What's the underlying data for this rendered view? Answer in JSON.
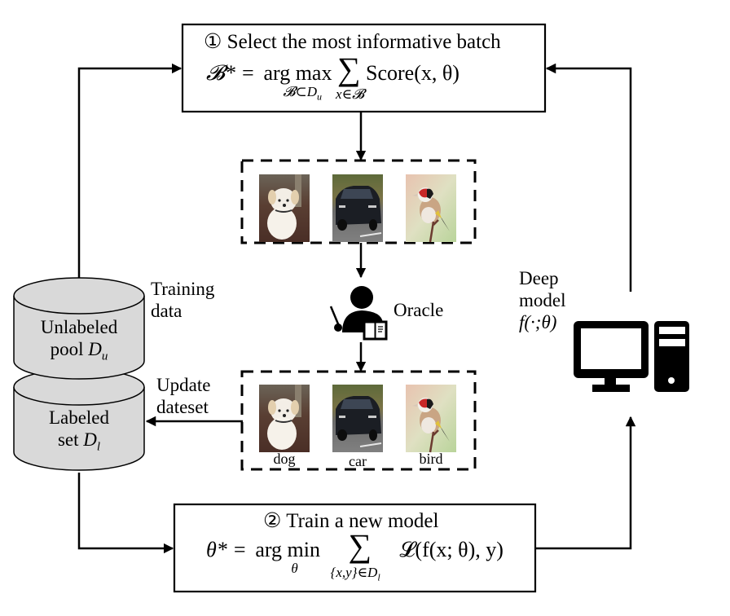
{
  "step1": {
    "number": "①",
    "title": "Select the most informative batch",
    "formula_lhs": "𝓑* =",
    "formula_op": "arg max",
    "formula_op_sub": "𝓑⊂D",
    "formula_op_sub_index": "u",
    "formula_sum": "∑",
    "formula_sum_sub": "x∈𝓑",
    "formula_rhs": "Score(x, θ)"
  },
  "step2": {
    "number": "②",
    "title": "Train a new model",
    "formula_lhs": "θ* =",
    "formula_op": "arg min",
    "formula_op_sub": "θ",
    "formula_sum": "∑",
    "formula_sum_sub": "{x,y}∈D",
    "formula_sum_sub_index": "l",
    "formula_rhs": "𝓛(f(x; θ), y)"
  },
  "unlabeled_pool": {
    "line1": "Unlabeled",
    "line2": "pool ",
    "symbol": "D",
    "index": "u"
  },
  "labeled_set": {
    "line1": "Labeled",
    "line2": "set ",
    "symbol": "D",
    "index": "l"
  },
  "training_data_label": [
    "Training",
    "data"
  ],
  "update_dataset_label": [
    "Update",
    "dateset"
  ],
  "oracle_label": "Oracle",
  "deep_model_label": [
    "Deep",
    "model",
    "f(·;θ)"
  ],
  "unlabeled_batch": {
    "images": [
      {
        "icon": "dog-photo",
        "caption": ""
      },
      {
        "icon": "car-photo",
        "caption": ""
      },
      {
        "icon": "bird-photo",
        "caption": ""
      }
    ]
  },
  "labeled_batch": {
    "images": [
      {
        "icon": "dog-photo",
        "caption": "dog"
      },
      {
        "icon": "car-photo",
        "caption": "car"
      },
      {
        "icon": "bird-photo",
        "caption": "bird"
      }
    ]
  },
  "colors": {
    "line": "#000000",
    "cylinder_fill": "#d9d9d9",
    "background": "#ffffff"
  }
}
